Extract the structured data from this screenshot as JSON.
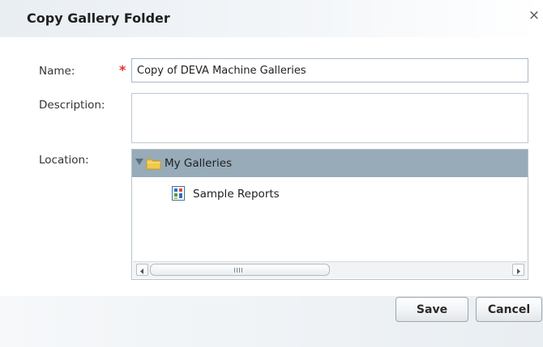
{
  "dialog": {
    "title": "Copy Gallery Folder",
    "close_glyph": "×"
  },
  "form": {
    "name_label": "Name:",
    "required_marker": "*",
    "name_value": "Copy of DEVA Machine Galleries",
    "description_label": "Description:",
    "description_value": "",
    "location_label": "Location:"
  },
  "tree": {
    "items": [
      {
        "label": "My Galleries",
        "icon": "folder-icon",
        "expanded": true,
        "selected": true
      },
      {
        "label": "Sample Reports",
        "icon": "report-icon",
        "selected": false
      }
    ]
  },
  "buttons": {
    "save": "Save",
    "cancel": "Cancel"
  },
  "colors": {
    "selected_row": "#97abb8",
    "required": "#e03030",
    "folder": "#f2c94c"
  }
}
